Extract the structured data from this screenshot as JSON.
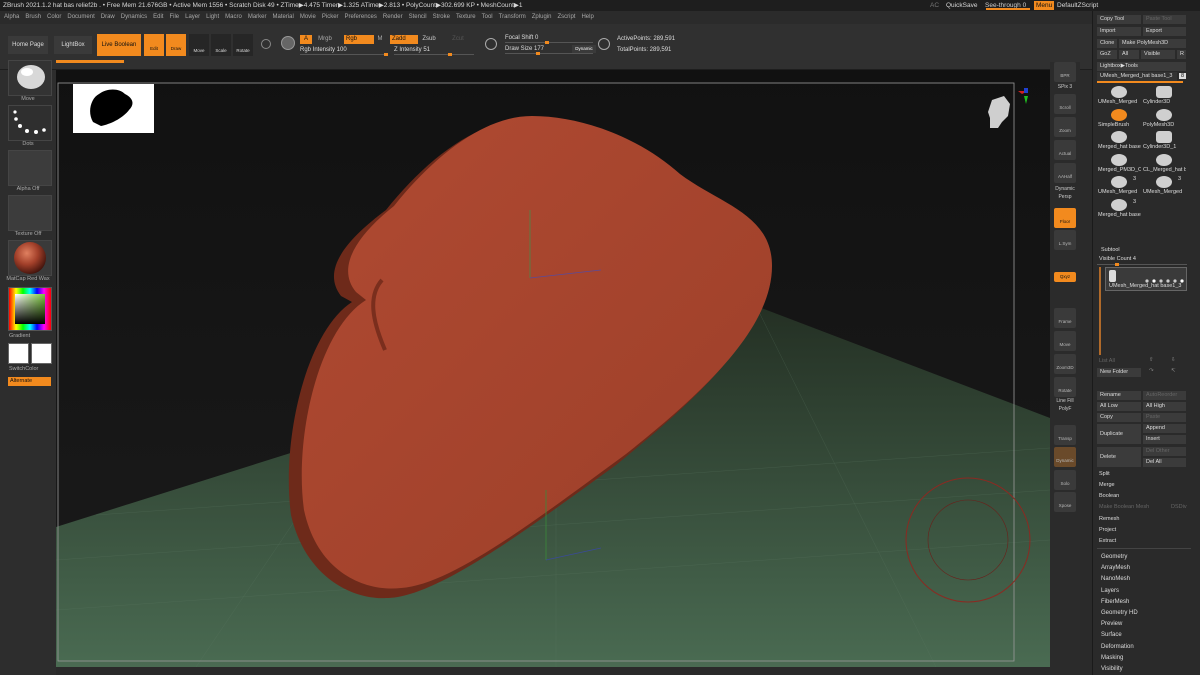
{
  "titlebar": {
    "text": "ZBrush 2021.1.2   hat bas relief2b  . • Free Mem 21.676GB • Active Mem 1556 • Scratch Disk 49 •  ZTime▶4.475 Timer▶1.325 ATime▶2.813 • PolyCount▶302.699 KP  • MeshCount▶1",
    "ac": "AC",
    "quicksave": "QuickSave",
    "see_through": "See-through  0",
    "menu": "Menu",
    "script": "DefaultZScript"
  },
  "menus": [
    "Alpha",
    "Brush",
    "Color",
    "Document",
    "Draw",
    "Dynamics",
    "Edit",
    "File",
    "Layer",
    "Light",
    "Macro",
    "Marker",
    "Material",
    "Movie",
    "Picker",
    "Preferences",
    "Render",
    "Stencil",
    "Stroke",
    "Texture",
    "Tool",
    "Transform",
    "Zplugin",
    "Zscript",
    "Help"
  ],
  "top": {
    "home": "Home Page",
    "lightbox": "LightBox",
    "live_boolean": "Live Boolean",
    "edit": "Edit",
    "draw": "Draw",
    "move": "Move",
    "scale": "Scale",
    "rotate": "Rotate",
    "a": "A",
    "mrgb": "Mrgb",
    "rgb": "Rgb",
    "m": "M",
    "zadd": "Zadd",
    "zsub": "Zsub",
    "zcut": "Zcut",
    "rgb_intensity": "Rgb Intensity 100",
    "z_intensity": "Z Intensity 51",
    "focal_shift": "Focal Shift 0",
    "draw_size": "Draw Size 177",
    "dynamic": "Dynamic",
    "active_points": "ActivePoints: 289,591",
    "total_points": "TotalPoints: 289,591"
  },
  "left": {
    "move": "Move",
    "dots": "Dots",
    "alpha_off": "Alpha Off",
    "texture_off": "Texture Off",
    "matcap": "MatCap Red Wax",
    "gradient": "Gradient",
    "switchcolor": "SwitchColor",
    "alternate": "Alternate"
  },
  "right": {
    "bpr": "BPR",
    "spix": "SPix 3",
    "scroll": "Scroll",
    "zoom": "Zoom",
    "actual": "Actual",
    "aahalf": "AAHalf",
    "dynamic": "Dynamic",
    "persp": "Persp",
    "floor": "Floor",
    "lsym": "L.Sym",
    "xyz": "Qxyz",
    "frame": "Frame",
    "move": "Move",
    "zoom3d": "Zoom3D",
    "rotate": "Rotate",
    "linefill": "Line Fill",
    "polyf": "PolyF",
    "transp": "Transp",
    "dynamic2": "Dynamic",
    "solo": "Solo",
    "xpose": "Xpose"
  },
  "tray": {
    "copy_tool": "Copy Tool",
    "paste_tool": "Paste Tool",
    "import": "Import",
    "export": "Export",
    "clone": "Clone",
    "make_polymesh": "Make PolyMesh3D",
    "goz": "GoZ",
    "all": "All",
    "visible": "Visible",
    "r": "R",
    "lightbox_tools": "Lightbox▶Tools",
    "current_tool": "UMesh_Merged_hat base1_3",
    "current_tool_count": "8",
    "tools": [
      {
        "name": "UMesh_Merged",
        "badge": ""
      },
      {
        "name": "Cylinder3D",
        "badge": ""
      },
      {
        "name": "SimpleBrush",
        "badge": ""
      },
      {
        "name": "PolyMesh3D",
        "badge": ""
      },
      {
        "name": "Merged_hat base",
        "badge": ""
      },
      {
        "name": "Cylinder3D_1",
        "badge": ""
      },
      {
        "name": "Merged_PM3D_C",
        "badge": ""
      },
      {
        "name": "CL_Merged_hat b",
        "badge": ""
      },
      {
        "name": "UMesh_Merged",
        "badge": "3"
      },
      {
        "name": "UMesh_Merged",
        "badge": "3"
      },
      {
        "name": "Merged_hat base",
        "badge": "3"
      }
    ],
    "subtool": "Subtool",
    "visible_count": "Visible Count 4",
    "subtool_name": "UMesh_Merged_hat base1_3",
    "list_all": "List All",
    "new_folder": "New Folder",
    "rename": "Rename",
    "autoreorder": "AutoReorder",
    "all_low": "All Low",
    "all_high": "All High",
    "copy": "Copy",
    "paste": "Paste",
    "duplicate": "Duplicate",
    "append": "Append",
    "insert": "Insert",
    "delete": "Delete",
    "del_other": "Del Other",
    "del_all": "Del All",
    "split": "Split",
    "merge": "Merge",
    "boolean": "Boolean",
    "make_boolean_mesh": "Make Boolean Mesh",
    "dsdiv": "DSDiv",
    "remesh": "Remesh",
    "project": "Project",
    "extract": "Extract"
  },
  "tool_menus": [
    "Geometry",
    "ArrayMesh",
    "NanoMesh",
    "Layers",
    "FiberMesh",
    "Geometry HD",
    "Preview",
    "Surface",
    "Deformation",
    "Masking",
    "Visibility"
  ],
  "colors": {
    "accent": "#f28a1e",
    "mesh": "#a9442d",
    "floor": "#3d5643"
  }
}
